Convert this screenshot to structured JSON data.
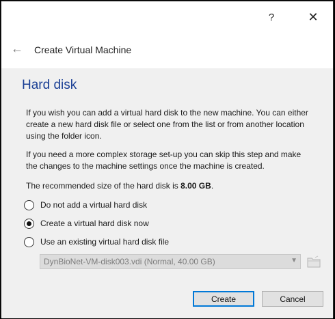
{
  "titlebar": {
    "help_label": "?",
    "close_label": "✕"
  },
  "header": {
    "back_icon": "←",
    "title": "Create Virtual Machine"
  },
  "page": {
    "heading": "Hard disk",
    "paragraph1": "If you wish you can add a virtual hard disk to the new machine. You can either create a new hard disk file or select one from the list or from another location using the folder icon.",
    "paragraph2": "If you need a more complex storage set-up you can skip this step and make the changes to the machine settings once the machine is created.",
    "recommended_prefix": "The recommended size of the hard disk is ",
    "recommended_size": "8.00 GB",
    "recommended_suffix": "."
  },
  "options": [
    {
      "label": "Do not add a virtual hard disk",
      "selected": false
    },
    {
      "label": "Create a virtual hard disk now",
      "selected": true
    },
    {
      "label": "Use an existing virtual hard disk file",
      "selected": false
    }
  ],
  "existing_disk": {
    "value": "DynBioNet-VM-disk003.vdi (Normal, 40.00 GB)",
    "enabled": false
  },
  "buttons": {
    "create": "Create",
    "cancel": "Cancel"
  },
  "colors": {
    "heading": "#1a3f95",
    "default_button_border": "#0078d7"
  }
}
